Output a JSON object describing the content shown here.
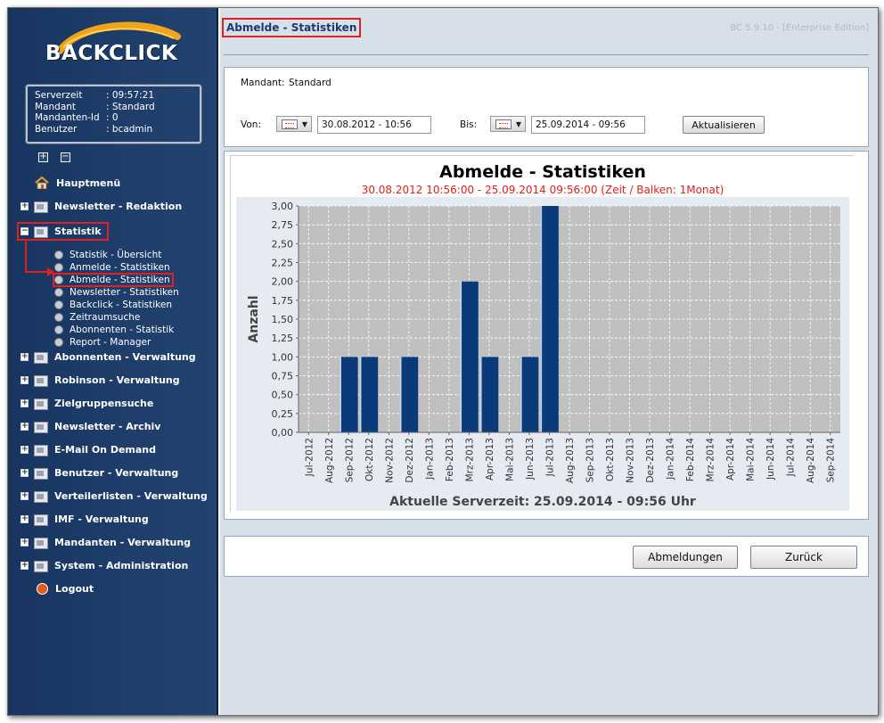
{
  "app": {
    "logo_text": "BACKCLICK",
    "version": "BC 5.9.10 - [Enterprise Edition]"
  },
  "info": {
    "rows": [
      {
        "key": "Serverzeit",
        "value": ": 09:57:21"
      },
      {
        "key": "Mandant",
        "value": ": Standard"
      },
      {
        "key": "Mandanten-Id",
        "value": ": 0"
      },
      {
        "key": "Benutzer",
        "value": ": bcadmin"
      }
    ]
  },
  "nav": {
    "main_menu": "Hauptmenü",
    "newsletter_redaktion": "Newsletter - Redaktion",
    "statistik": "Statistik",
    "sub": [
      "Statistik - Übersicht",
      "Anmelde - Statistiken",
      "Abmelde - Statistiken",
      "Newsletter - Statistiken",
      "Backclick - Statistiken",
      "Zeitraumsuche",
      "Abonnenten - Statistik",
      "Report - Manager"
    ],
    "sections": [
      "Abonnenten - Verwaltung",
      "Robinson - Verwaltung",
      "Zielgruppensuche",
      "Newsletter - Archiv",
      "E-Mail On Demand",
      "Benutzer - Verwaltung",
      "Verteilerlisten - Verwaltung",
      "IMF - Verwaltung",
      "Mandanten - Verwaltung",
      "System - Administration"
    ],
    "logout": "Logout"
  },
  "page": {
    "title": "Abmelde - Statistiken"
  },
  "form": {
    "mandant_label": "Mandant:",
    "mandant_value": "Standard",
    "von_label": "Von:",
    "von_value": "30.08.2012 - 10:56",
    "bis_label": "Bis:",
    "bis_value": "25.09.2014 - 09:56",
    "refresh_label": "Aktualisieren"
  },
  "buttons": {
    "abmeldungen": "Abmeldungen",
    "zurueck": "Zurück"
  },
  "chart_data": {
    "type": "bar",
    "title": "Abmelde - Statistiken",
    "subtitle": "30.08.2012 10:56:00 - 25.09.2014 09:56:00  (Zeit / Balken: 1Monat)",
    "ylabel": "Anzahl",
    "xlabel": "Aktuelle Serverzeit: 25.09.2014 - 09:56 Uhr",
    "ylim": [
      0,
      3
    ],
    "ytick_step": 0.25,
    "grid": true,
    "categories": [
      "Jul-2012",
      "Aug-2012",
      "Sep-2012",
      "Okt-2012",
      "Nov-2012",
      "Dez-2012",
      "Jan-2013",
      "Feb-2013",
      "Mrz-2013",
      "Apr-2013",
      "Mai-2013",
      "Jun-2013",
      "Jul-2013",
      "Aug-2013",
      "Sep-2013",
      "Okt-2013",
      "Nov-2013",
      "Dez-2013",
      "Jan-2014",
      "Feb-2014",
      "Mrz-2014",
      "Apr-2014",
      "Mai-2014",
      "Jun-2014",
      "Jul-2014",
      "Aug-2014",
      "Sep-2014"
    ],
    "values": [
      0,
      0,
      1,
      1,
      0,
      1,
      0,
      0,
      2,
      1,
      0,
      1,
      3,
      0,
      0,
      0,
      0,
      0,
      0,
      0,
      0,
      0,
      0,
      0,
      0,
      0,
      0
    ],
    "colors": {
      "bar": "#0a3a7a",
      "plot_bg": "#c0c0c0",
      "subtitle": "#e0211d"
    }
  }
}
